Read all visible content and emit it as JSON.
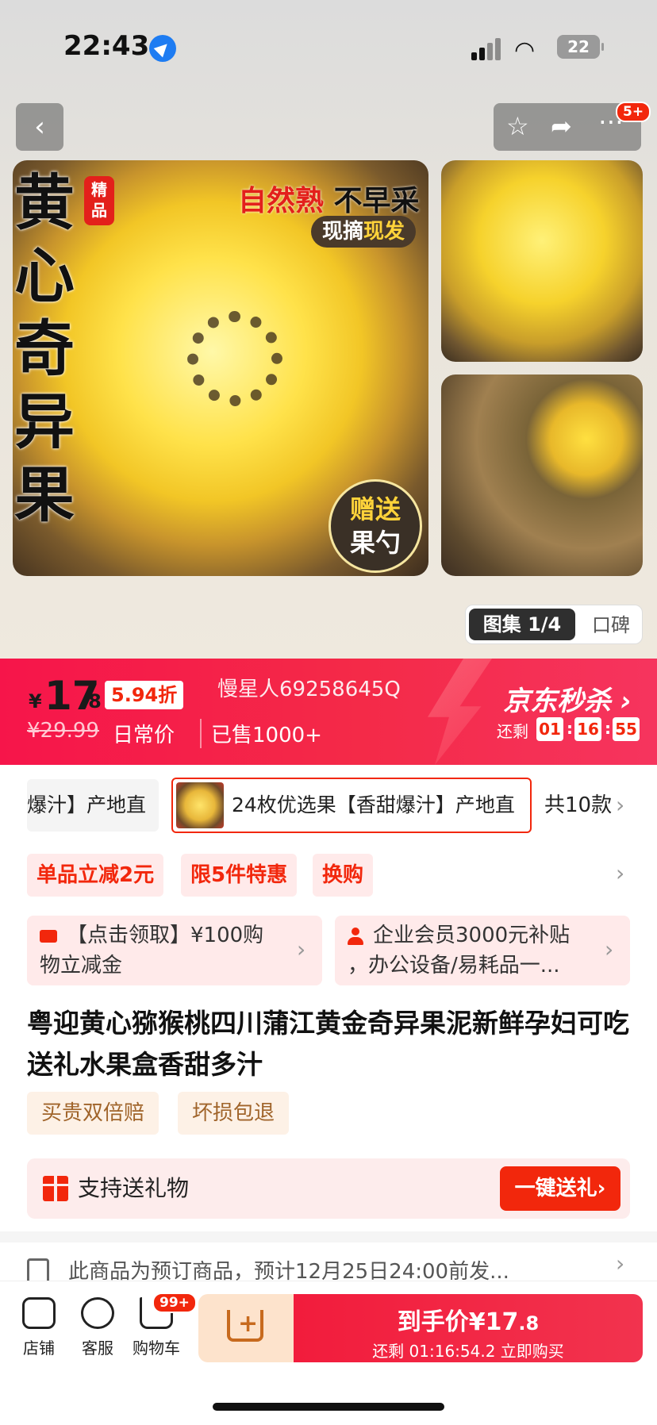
{
  "status": {
    "time": "22:43",
    "battery": "22"
  },
  "header": {
    "back_label": "‹",
    "notif_badge": "5+"
  },
  "hero": {
    "title_vertical": "黄心奇异果",
    "seal": "精品",
    "slogan_red": "自然熟",
    "slogan_black": " 不早采",
    "pill_a": "现摘",
    "pill_b": "现发",
    "gift_line1": "赠送",
    "gift_line2": "果勺",
    "gallery_selected": "图集 1/4",
    "gallery_other": "口碑"
  },
  "price": {
    "yen": "¥",
    "integer": "17",
    "decimal": ".8",
    "discount": "5.94折",
    "watermark": "慢星人69258645Q",
    "original": "¥29.99",
    "daily": "日常价",
    "sold": "已售1000+",
    "seckill": "京东秒杀",
    "remain_label": "还剩",
    "cd_h": "01",
    "cd_m": "16",
    "cd_s": "55"
  },
  "variants": {
    "prev_label": "爆汁】产地直",
    "selected_label": "24枚优选果【香甜爆汁】产地直",
    "count": "共10款"
  },
  "promos": [
    "单品立减2元",
    "限5件特惠",
    "换购"
  ],
  "coupons": [
    {
      "line1": "【点击领取】¥100购",
      "line2": "物立减金"
    },
    {
      "line1": "企业会员3000元补贴",
      "line2": "，办公设备/易耗品一..."
    }
  ],
  "product": {
    "title": "粤迎黄心猕猴桃四川蒲江黄金奇异果泥新鲜孕妇可吃送礼水果盒香甜多汁",
    "tags": [
      "买贵双倍赔",
      "坏损包退"
    ]
  },
  "gift": {
    "text": "支持送礼物",
    "button": "一键送礼"
  },
  "notice": {
    "text": "此商品为预订商品，预计12月25日24:00前发..."
  },
  "bottom": {
    "shop": "店铺",
    "service": "客服",
    "cart": "购物车",
    "cart_badge": "99+",
    "buy_main": "到手价¥17",
    "buy_dec": ".8",
    "buy_sub": "还剩 01:16:54.2 立即购买"
  }
}
